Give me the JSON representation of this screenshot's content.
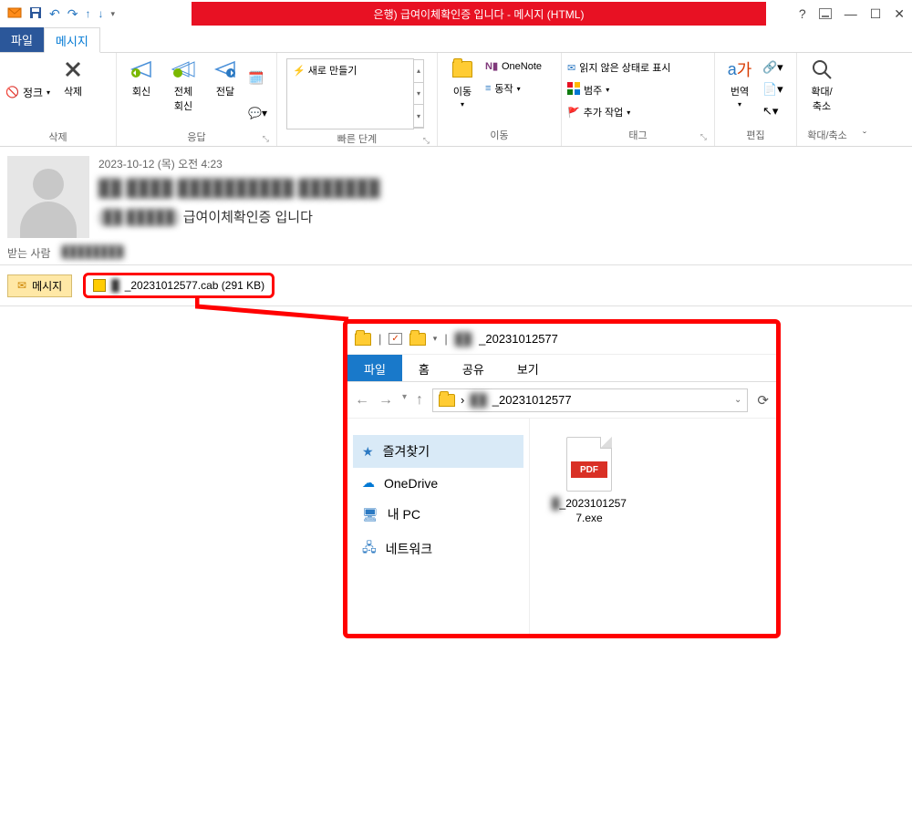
{
  "titlebar": {
    "title": "은행) 급여이체확인증 입니다 -  메시지 (HTML)"
  },
  "tabs": {
    "file": "파일",
    "message": "메시지"
  },
  "ribbon": {
    "junk": "정크",
    "delete": "삭제",
    "delete_group": "삭제",
    "reply": "회신",
    "reply_all": "전체\n회신",
    "forward": "전달",
    "respond_group": "응답",
    "quick_new": "새로 만들기",
    "quick_group": "빠른 단계",
    "move": "이동",
    "onenote": "OneNote",
    "actions": "동작",
    "move_group": "이동",
    "unread": "읽지 않은 상태로 표시",
    "categorize": "범주",
    "followup": "추가 작업",
    "tags_group": "태그",
    "translate": "번역",
    "edit_group": "편집",
    "zoom": "확대/\n축소",
    "zoom_group": "확대/축소"
  },
  "msg": {
    "date": "2023-10-12 (목) 오전 4:23",
    "subject_prefix": ")",
    "subject": "급여이체확인증 입니다",
    "recipient_label": "받는 사람"
  },
  "attach": {
    "msg_tab": "메시지",
    "filename": "_20231012577.cab (291 KB)"
  },
  "explorer": {
    "title": "_20231012577",
    "tabs": {
      "file": "파일",
      "home": "홈",
      "share": "공유",
      "view": "보기"
    },
    "addr": "_20231012577",
    "side": {
      "favorites": "즐겨찾기",
      "onedrive": "OneDrive",
      "thispc": "내 PC",
      "network": "네트워크"
    },
    "file": {
      "badge": "PDF",
      "name": "_20231012577.exe"
    }
  }
}
